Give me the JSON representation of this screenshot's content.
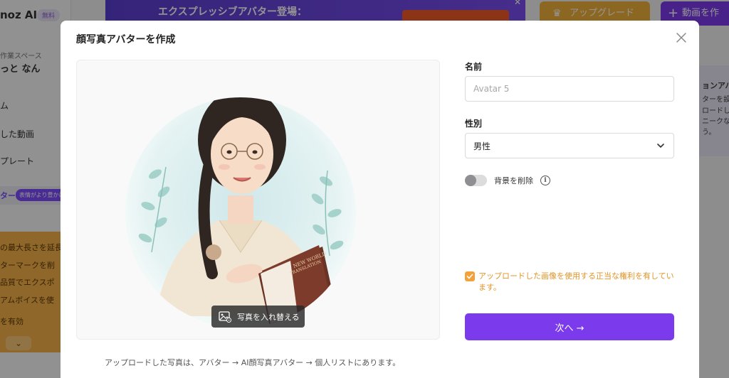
{
  "background": {
    "logo": "noz AI",
    "free_badge": "無料",
    "workspace_label": "作業スペース",
    "user_name": "っと なん",
    "nav_items": [
      "ム",
      "した動画",
      "プレート"
    ],
    "ai_avatar_label": "ター",
    "ai_avatar_pill": "表情がより豊かに",
    "promo_lines": [
      "の最大長さを延長",
      "ターマークを削",
      "品質でエクスポ",
      "アムボイスを使",
      "を有効"
    ],
    "banner_title": "エクスプレッシブアバター登場：",
    "upgrade_label": "アップグレード",
    "new_video_label": "動画を作",
    "right_card_lines": [
      "ョンアバ",
      "ターを設",
      "ロードし",
      "ニークな",
      "う。"
    ]
  },
  "modal": {
    "title": "顔写真アバターを作成",
    "photo_replace_label": "写真を入れ替える",
    "photo_note": "アップロードした写真は、アバター → AI顔写真アバター → 個人リストにあります。",
    "name_label": "名前",
    "name_placeholder": "Avatar 5",
    "name_value": "",
    "gender_label": "性別",
    "gender_value": "男性",
    "remove_bg_label": "背景を削除",
    "remove_bg_enabled": false,
    "consent_checked": true,
    "consent_text": "アップロードした画像を使用する正当な権利を有しています。",
    "next_label": "次へ →",
    "book_text_1": "NEW WORLD",
    "book_text_2": "TRANSLATION"
  },
  "colors": {
    "primary": "#7c3aed",
    "consent": "#e39426",
    "upgrade": "#f2b23c"
  }
}
